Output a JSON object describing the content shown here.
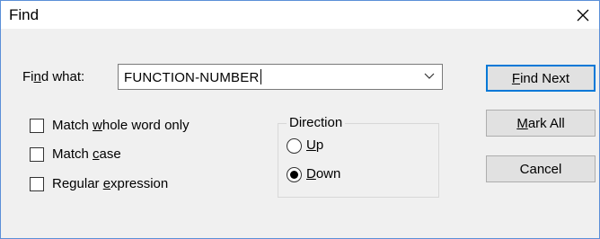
{
  "window": {
    "title": "Find"
  },
  "find_what": {
    "label_pre": "Fi",
    "label_u": "n",
    "label_post": "d what:",
    "value": "FUNCTION-NUMBER"
  },
  "options": {
    "whole_word": {
      "pre": "Match ",
      "u": "w",
      "post": "hole word only",
      "checked": false
    },
    "match_case": {
      "pre": "Match ",
      "u": "c",
      "post": "ase",
      "checked": false
    },
    "regex": {
      "pre": "Regular ",
      "u": "e",
      "post": "xpression",
      "checked": false
    }
  },
  "direction": {
    "legend": "Direction",
    "up": {
      "u": "U",
      "post": "p",
      "selected": false
    },
    "down": {
      "u": "D",
      "post": "own",
      "selected": true
    }
  },
  "buttons": {
    "find_next": {
      "u": "F",
      "post": "ind Next"
    },
    "mark_all": {
      "u": "M",
      "post": "ark All"
    },
    "cancel": {
      "label": "Cancel"
    }
  },
  "icons": {
    "close": "close-icon",
    "dropdown": "chevron-down-icon"
  },
  "colors": {
    "default_button_border": "#0078d7",
    "window_border": "#5b8fd8"
  }
}
